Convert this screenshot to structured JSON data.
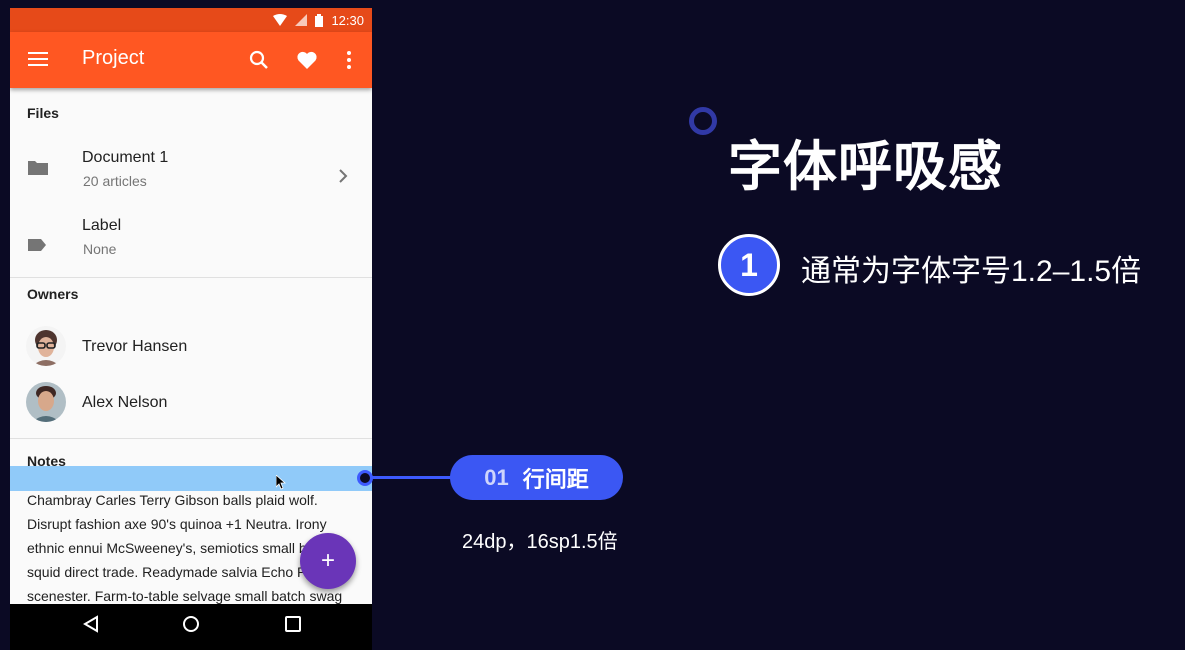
{
  "status_bar": {
    "time": "12:30"
  },
  "toolbar": {
    "title": "Project"
  },
  "files": {
    "header": "Files",
    "items": [
      {
        "title": "Document 1",
        "subtitle": "20 articles"
      },
      {
        "title": "Label",
        "subtitle": "None"
      }
    ]
  },
  "owners": {
    "header": "Owners",
    "people": [
      {
        "name": "Trevor Hansen"
      },
      {
        "name": "Alex Nelson"
      }
    ]
  },
  "notes": {
    "header": "Notes",
    "lines": [
      "Chambray Carles Terry Gibson balls plaid wolf.",
      "Disrupt fashion axe 90's quinoa +1 Neutra. Irony",
      "ethnic ennui McSweeney's, semiotics small b",
      "squid direct trade. Readymade salvia Echo P",
      "scenester. Farm-to-table selvage small batch swag"
    ]
  },
  "fab": {
    "label": "+"
  },
  "callout": {
    "number": "01",
    "label": "行间距",
    "note": "24dp，16sp1.5倍"
  },
  "slide": {
    "heading": "字体呼吸感",
    "point_number": "1",
    "point_text": "通常为字体字号1.2–1.5倍"
  },
  "colors": {
    "primary": "#ff5722",
    "primary_dark": "#e64a19",
    "accent": "#6a35b8",
    "callout": "#3b57f3",
    "background": "#0b0a24"
  }
}
